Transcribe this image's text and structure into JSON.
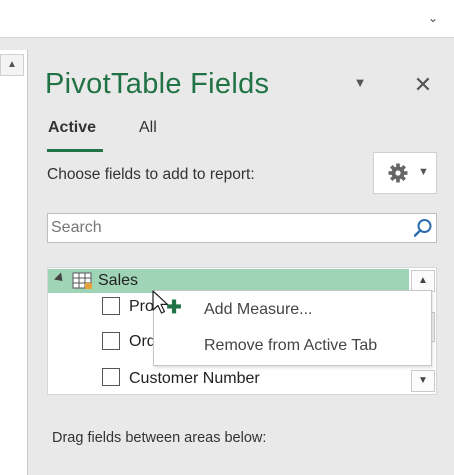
{
  "top_bar": {
    "chevron_icon": "chevron-down-icon"
  },
  "sheet": {
    "scroll_up_icon": "triangle-up-icon"
  },
  "pane": {
    "title": "PivotTable Fields",
    "title_dropdown_icon": "triangle-down-icon",
    "close_icon": "close-icon",
    "tabs": [
      {
        "label": "Active",
        "selected": true
      },
      {
        "label": "All",
        "selected": false
      }
    ],
    "instruction": "Choose fields to add to report:",
    "settings_icon": "gear-icon",
    "search": {
      "placeholder": "Search",
      "value": "",
      "icon": "search-icon"
    },
    "field_list": {
      "table": {
        "name": "Sales",
        "expanded": true,
        "icon": "table-icon"
      },
      "fields": [
        {
          "label": "Pro",
          "checked": false
        },
        {
          "label": "Ord",
          "checked": false
        },
        {
          "label": "Customer Number",
          "checked": false
        }
      ]
    },
    "context_menu": {
      "items": [
        {
          "label": "Add Measure...",
          "icon": "plus-icon"
        },
        {
          "label": "Remove from Active Tab"
        }
      ]
    },
    "drag_hint": "Drag fields between areas below:"
  },
  "colors": {
    "accent": "#217346",
    "selection": "#9fd5b6",
    "pane_background": "#e9e9e9"
  }
}
